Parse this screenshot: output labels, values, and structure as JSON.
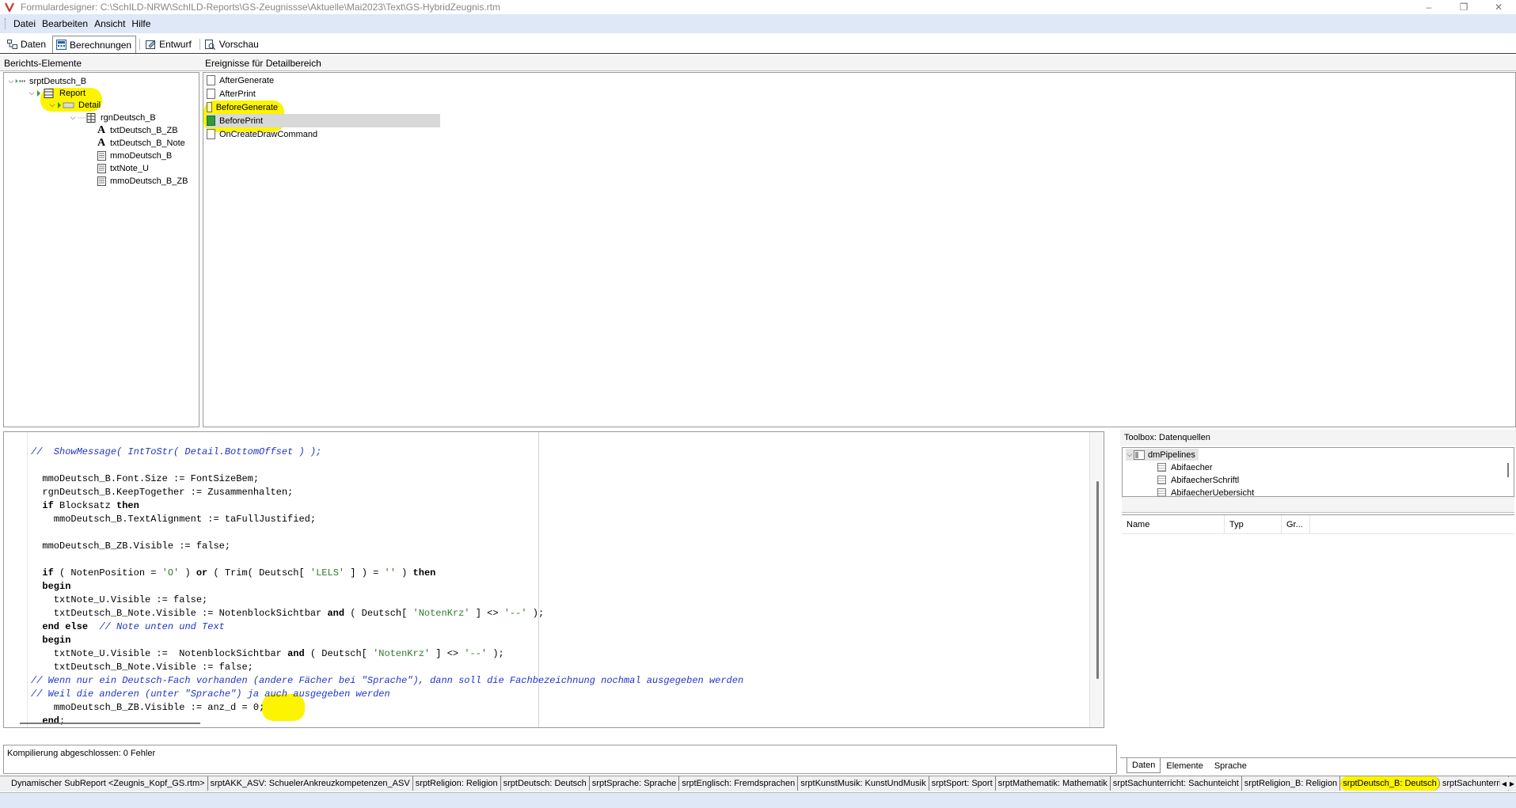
{
  "window": {
    "title": "Formulardesigner: C:\\SchILD-NRW\\SchILD-Reports\\GS-Zeugnissse\\Aktuelle\\Mai2023\\Text\\GS-HybridZeugnis.rtm"
  },
  "menu": {
    "items": [
      "Datei",
      "Bearbeiten",
      "Ansicht",
      "Hilfe"
    ]
  },
  "tabs": [
    {
      "label": "Daten",
      "icon": "data-icon",
      "active": false
    },
    {
      "label": "Berechnungen",
      "icon": "calc-icon",
      "active": true
    },
    {
      "label": "Entwurf",
      "icon": "design-icon",
      "active": false
    },
    {
      "label": "Vorschau",
      "icon": "preview-icon",
      "active": false
    }
  ],
  "tree": {
    "header": "Berichts-Elemente",
    "nodes": [
      {
        "label": "srptDeutsch_B",
        "icon": "subreport-icon"
      },
      {
        "label": "Report",
        "icon": "report-icon"
      },
      {
        "label": "Detail",
        "icon": "band-icon"
      },
      {
        "label": "rgnDeutsch_B",
        "icon": "region-icon"
      },
      {
        "label": "txtDeutsch_B_ZB",
        "icon": "text-icon"
      },
      {
        "label": "txtDeutsch_B_Note",
        "icon": "text-icon"
      },
      {
        "label": "mmoDeutsch_B",
        "icon": "memo-icon"
      },
      {
        "label": "txtNote_U",
        "icon": "memo-icon"
      },
      {
        "label": "mmoDeutsch_B_ZB",
        "icon": "memo-icon"
      }
    ]
  },
  "events": {
    "header": "Ereignisse für Detailbereich",
    "items": [
      {
        "label": "AfterGenerate"
      },
      {
        "label": "AfterPrint"
      },
      {
        "label": "BeforeGenerate"
      },
      {
        "label": "BeforePrint"
      },
      {
        "label": "OnCreateDrawCommand"
      }
    ],
    "selected": "BeforePrint"
  },
  "code": {
    "lines": [
      "//  ShowMessage( IntToStr( Detail.BottomOffset ) );",
      "",
      "  mmoDeutsch_B.Font.Size := FontSizeBem;",
      "  rgnDeutsch_B.KeepTogether := Zusammenhalten;",
      "  if Blocksatz then",
      "    mmoDeutsch_B.TextAlignment := taFullJustified;",
      "",
      "  mmoDeutsch_B_ZB.Visible := false;",
      "",
      "  if ( NotenPosition = 'O' ) or ( Trim( Deutsch[ 'LELS' ] ) = '' ) then",
      "  begin",
      "    txtNote_U.Visible := false;",
      "    txtDeutsch_B_Note.Visible := NotenblockSichtbar and ( Deutsch[ 'NotenKrz' ] <> '--' );",
      "  end else  // Note unten und Text",
      "  begin",
      "    txtNote_U.Visible :=  NotenblockSichtbar and ( Deutsch[ 'NotenKrz' ] <> '--' );",
      "    txtDeutsch_B_Note.Visible := false;",
      "// Wenn nur ein Deutsch-Fach vorhanden (andere Fächer bei \"Sprache\"), dann soll die Fachbezeichnung nochmal ausgegeben werden",
      "// Weil die anderen (unter \"Sprache\") ja auch ausgegeben werden",
      "    mmoDeutsch_B_ZB.Visible := anz_d = 0;",
      "  end;"
    ]
  },
  "compile": {
    "message": "Kompilierung abgeschlossen: 0 Fehler"
  },
  "toolbox": {
    "header": "Toolbox: Datenquellen",
    "root": "dmPipelines",
    "items": [
      "Abifaecher",
      "AbifaecherSchriftl",
      "AbifaecherUebersicht"
    ],
    "columns": [
      "Name",
      "Typ",
      "Gr..."
    ],
    "tabs": [
      "Daten",
      "Elemente",
      "Sprache"
    ],
    "active_tab": "Daten"
  },
  "subreports": {
    "tabs": [
      "Dynamischer SubReport <Zeugnis_Kopf_GS.rtm>",
      "srptAKK_ASV: SchuelerAnkreuzkompetenzen_ASV",
      "srptReligion: Religion",
      "srptDeutsch: Deutsch",
      "srptSprache: Sprache",
      "srptEnglisch: Fremdsprachen",
      "srptKunstMusik: KunstUndMusik",
      "srptSport: Sport",
      "srptMathematik: Mathematik",
      "srptSachunterricht: Sachunteicht",
      "srptReligion_B: Religion",
      "srptDeutsch_B: Deutsch",
      "srptSachunterric"
    ],
    "active": "srptDeutsch_B: Deutsch"
  },
  "colors": {
    "highlight": "#fcf400",
    "comment": "#1f35c6",
    "string": "#2f7a2f",
    "menubar": "#dfe8f6"
  }
}
